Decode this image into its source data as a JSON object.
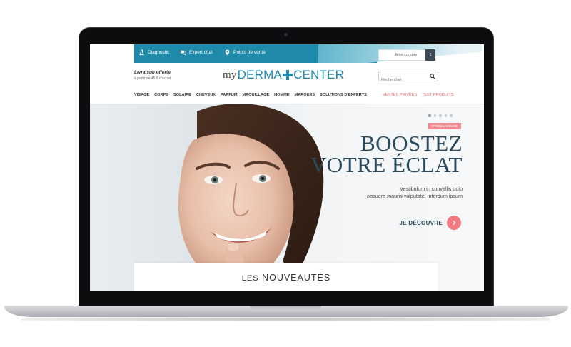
{
  "topbar": {
    "diagnostic": "Diagnostic",
    "expert_chat": "Expert chat",
    "stores": "Points de vente",
    "account": "Mon compte",
    "cart_count": "1"
  },
  "header": {
    "delivery_title": "Livraison offerte",
    "delivery_sub": "à partir de 45 € d'achat",
    "logo_prefix": "my",
    "logo_left": "DERMA",
    "logo_right": "CENTER",
    "search_placeholder": "Rechercher"
  },
  "nav": {
    "items": [
      "VISAGE",
      "CORPS",
      "SOLAIRE",
      "CHEVEUX",
      "PARFUM",
      "MAQUILLAGE",
      "HOMME",
      "MARQUES",
      "SOLUTIONS D'EXPERTS"
    ],
    "promo_items": [
      "VENTES PRIVÉES",
      "TEST PRODUITS"
    ]
  },
  "hero": {
    "badge": "SPÉCIAL VISAGE",
    "title_line1": "BOOSTEZ",
    "title_line2": "VOTRE ÉCLAT",
    "text_line1": "Vestibulum in convallis odio",
    "text_line2": "posuere mauris vulputate, interdum ipsum",
    "cta": "JE DÉCOUVRE",
    "slides": 5,
    "active_slide": 1
  },
  "news": {
    "title_prefix": "LES",
    "title_main": "NOUVEAUTÉS"
  },
  "colors": {
    "brand_blue": "#1f8aa9",
    "navy": "#2a4a5e",
    "coral": "#f07b80"
  }
}
